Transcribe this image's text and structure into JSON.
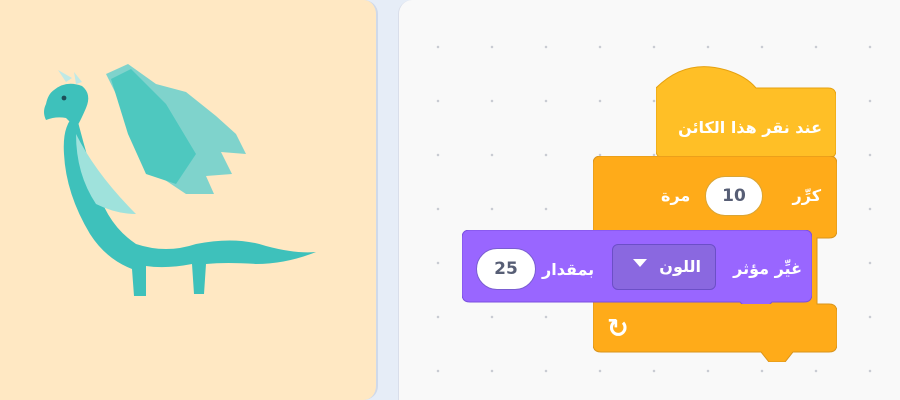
{
  "stage": {
    "sprite": "dragon"
  },
  "blocks": {
    "hat": {
      "label": "عند نقر هذا الكائن",
      "color": "#ffbf26"
    },
    "repeat": {
      "label": "كرِّر",
      "times_value": "10",
      "times_label": "مرة",
      "color": "#ffab19",
      "loop_icon": "↻"
    },
    "effect": {
      "label": "غيِّر مؤثر",
      "dropdown_value": "اللون",
      "by_label": "بمقدار",
      "amount": "25",
      "color": "#9966ff"
    }
  },
  "colors": {
    "stage_bg": "#ffe8c3",
    "workspace_bg": "#f9f9f9",
    "dragon": "#3ec1bb"
  }
}
